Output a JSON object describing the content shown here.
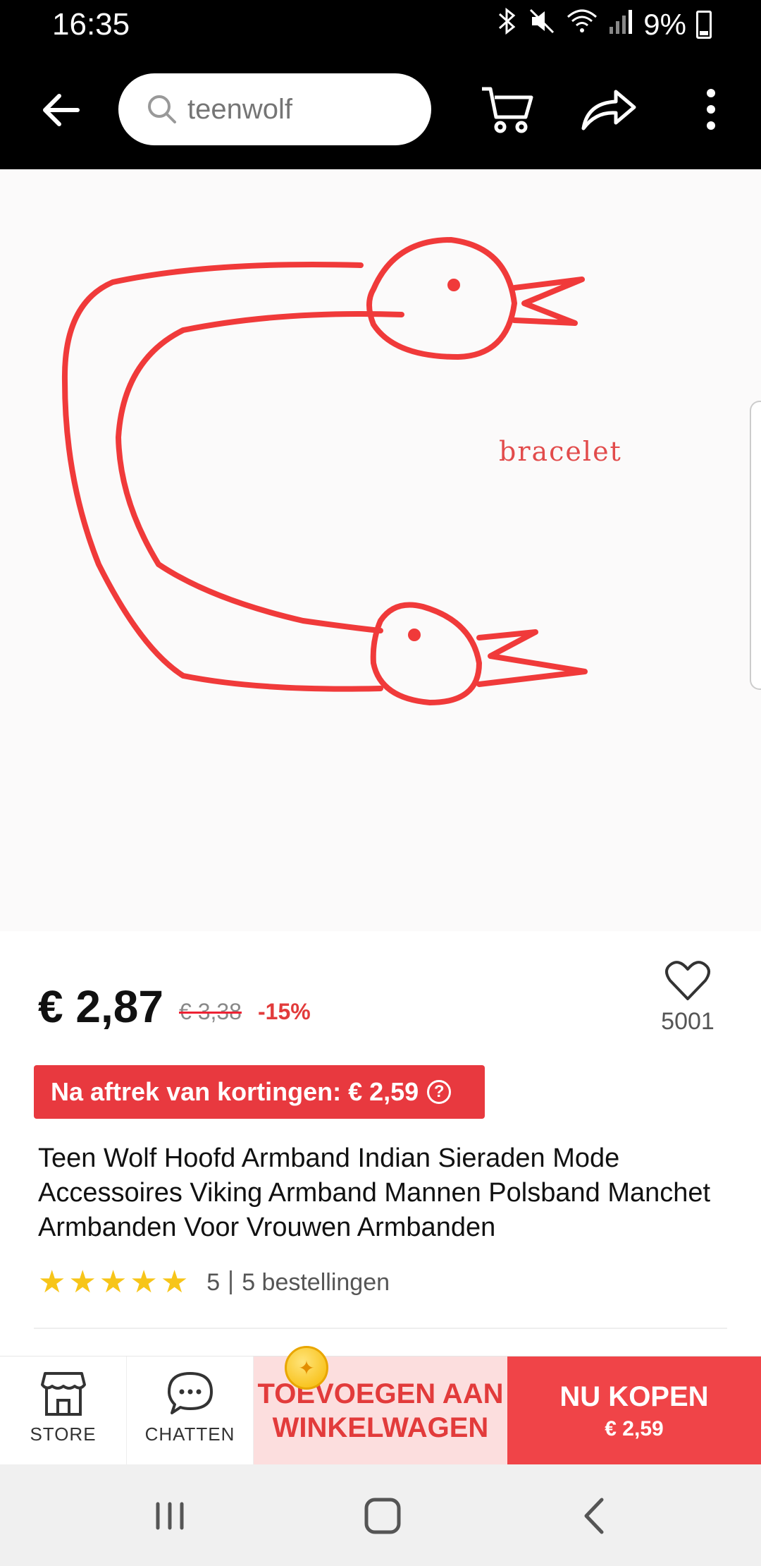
{
  "status_bar": {
    "time": "16:35",
    "battery": "9%"
  },
  "app_bar": {
    "search": {
      "value": "",
      "placeholder": "teenwolf"
    },
    "icons": [
      "back-arrow-icon",
      "search-icon",
      "cart-icon",
      "share-icon",
      "more-vertical-icon"
    ]
  },
  "product_image": {
    "caption": "bracelet",
    "drawing_color": "#f03a3a"
  },
  "product": {
    "price": "€ 2,87",
    "old_price": "€ 3,38",
    "discount": "-15%",
    "wishlist_count": "5001",
    "coupon_text": "Na aftrek van kortingen: € 2,59",
    "coupon_help": "?",
    "title": "Teen Wolf Hoofd Armband Indian Sieraden Mode Accessoires Viking Armband Mannen Polsband Manchet Armbanden Voor Vrouwen Armbanden",
    "rating": "5",
    "stars": 5,
    "orders": "5 bestellingen"
  },
  "action_bar": {
    "store_label": "STORE",
    "chat_label": "CHATTEN",
    "add_to_cart_line1": "TOEVOEGEN AAN",
    "add_to_cart_line2": "WINKELWAGEN",
    "buy_now_label": "NU KOPEN",
    "buy_now_price": "€ 2,59"
  },
  "colors": {
    "accent": "#f04448",
    "accent_light": "#fcdede",
    "star": "#f7c519"
  }
}
